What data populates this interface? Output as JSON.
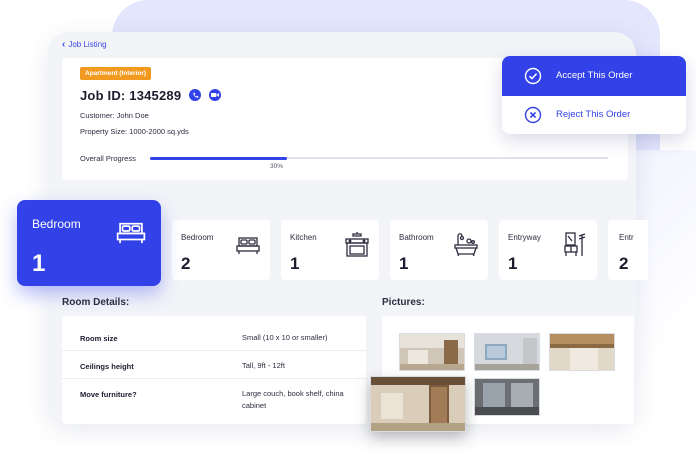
{
  "nav": {
    "back_label": "Job Listing"
  },
  "job": {
    "tag": "Apartment (Interior)",
    "id_label": "Job ID: 1345289",
    "customer": "Customer: John Doe",
    "property_size": "Property Size: 1000-2000 sq.yds",
    "progress_label": "Overall Progress",
    "progress_value": 30,
    "progress_text": "30%"
  },
  "actions": {
    "accept_label": "Accept This Order",
    "reject_label": "Reject This Order"
  },
  "active_room": {
    "name": "Bedroom",
    "count": "1",
    "icon": "bed-icon"
  },
  "rooms": [
    {
      "name": "Bedroom",
      "count": "2",
      "icon": "bed-icon"
    },
    {
      "name": "Kitchen",
      "count": "1",
      "icon": "stove-icon"
    },
    {
      "name": "Bathroom",
      "count": "1",
      "icon": "bathtub-icon"
    },
    {
      "name": "Entryway",
      "count": "1",
      "icon": "entryway-icon"
    },
    {
      "name": "Entr",
      "count": "2",
      "icon": ""
    }
  ],
  "details": {
    "title": "Room Details:",
    "rows": [
      {
        "label": "Room size",
        "value": "Small (10 x 10 or smaller)"
      },
      {
        "label": "Ceilings height",
        "value": "Tall, 9ft - 12ft"
      },
      {
        "label": "Move furniture?",
        "value": "Large couch, book shelf, china cabinet"
      }
    ]
  },
  "pictures": {
    "title": "Pictures:"
  },
  "colors": {
    "accent": "#3242e8",
    "tag": "#f29a1f",
    "background": "#f3f4f8"
  }
}
